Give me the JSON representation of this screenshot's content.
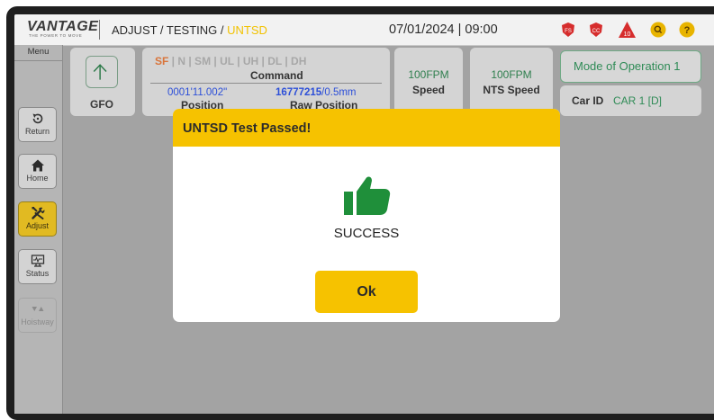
{
  "header": {
    "logo_text": "VANTAGE",
    "logo_tagline": "THE POWER TO MOVE",
    "breadcrumb_prefix": "ADJUST / TESTING / ",
    "breadcrumb_current": "UNTSD",
    "datetime": "07/01/2024 | 09:00",
    "status_icons": [
      {
        "name": "fire-service-icon",
        "label": "FS",
        "color": "#d62d2d"
      },
      {
        "name": "car-call-icon",
        "label": "CC",
        "color": "#d62d2d"
      },
      {
        "name": "warning-icon",
        "label": "10",
        "color": "#d62d2d"
      },
      {
        "name": "search-icon",
        "color": "#e8b400"
      },
      {
        "name": "help-icon",
        "label": "?",
        "color": "#e8b400"
      }
    ]
  },
  "sidebar": {
    "title": "Menu",
    "items": [
      {
        "label": "Return",
        "icon": "return-icon",
        "state": "normal"
      },
      {
        "label": "Home",
        "icon": "home-icon",
        "state": "normal"
      },
      {
        "label": "Adjust",
        "icon": "tools-icon",
        "state": "active"
      },
      {
        "label": "Status",
        "icon": "monitor-icon",
        "state": "normal"
      },
      {
        "label": "Hoistway",
        "icon": "hoistway-icon",
        "state": "disabled"
      }
    ]
  },
  "info_panel": {
    "gfo_label": "GFO",
    "flags": {
      "active": "SF",
      "rest": [
        " | N | SM | UL | UH | DL | DH"
      ]
    },
    "command_label": "Command",
    "position_value": "0001'11.002\"",
    "position_label": "Position",
    "raw_position_value_bold": "16777215",
    "raw_position_value_rest": "/0.5mm",
    "raw_position_label": "Raw Position",
    "speed_value": "100FPM",
    "speed_label": "Speed",
    "nts_speed_value": "100FPM",
    "nts_speed_label": "NTS Speed",
    "mode": "Mode of Operation 1",
    "car_id_label": "Car ID",
    "car_id_value": "CAR 1 [D]"
  },
  "dialog": {
    "title": "UNTSD Test Passed!",
    "icon": "thumbs-up-icon",
    "status_text": "SUCCESS",
    "ok_label": "Ok",
    "colors": {
      "header": "#f6c200",
      "icon": "#1f8f3a"
    }
  }
}
